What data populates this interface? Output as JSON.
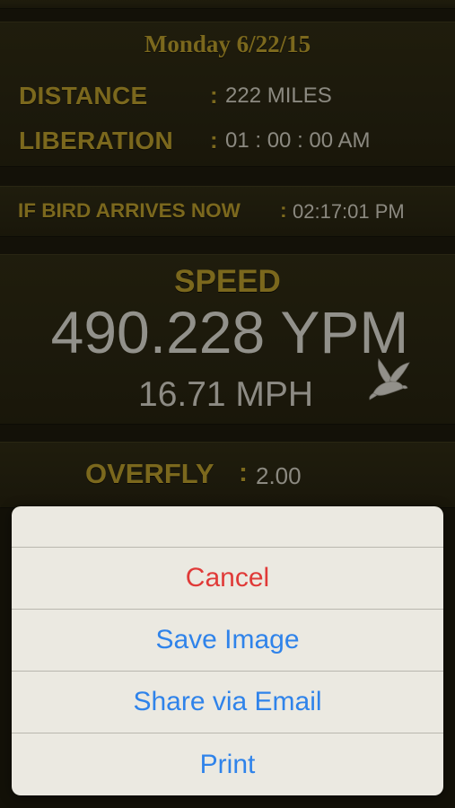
{
  "header": {
    "date": "Monday  6/22/15"
  },
  "info": {
    "distance_label": "DISTANCE",
    "distance_value": "222 MILES",
    "liberation_label": "LIBERATION",
    "liberation_value": "01 : 00 : 00 AM",
    "colon": ":"
  },
  "arrival": {
    "label": "IF BIRD ARRIVES NOW",
    "colon": ":",
    "value": "02:17:01 PM"
  },
  "speed": {
    "label": "SPEED",
    "ypm": "490.228 YPM",
    "mph": "16.71 MPH",
    "icon": "dove-icon"
  },
  "overfly": {
    "label": "OVERFLY",
    "colon": ":",
    "value": "2.00"
  },
  "action_sheet": {
    "cancel": "Cancel",
    "save_image": "Save Image",
    "share_email": "Share via Email",
    "print": "Print"
  },
  "colors": {
    "gold": "#b59a2c",
    "background": "#1c1a0d",
    "ios_blue": "#2f83ea",
    "destructive_red": "#e03a38"
  }
}
